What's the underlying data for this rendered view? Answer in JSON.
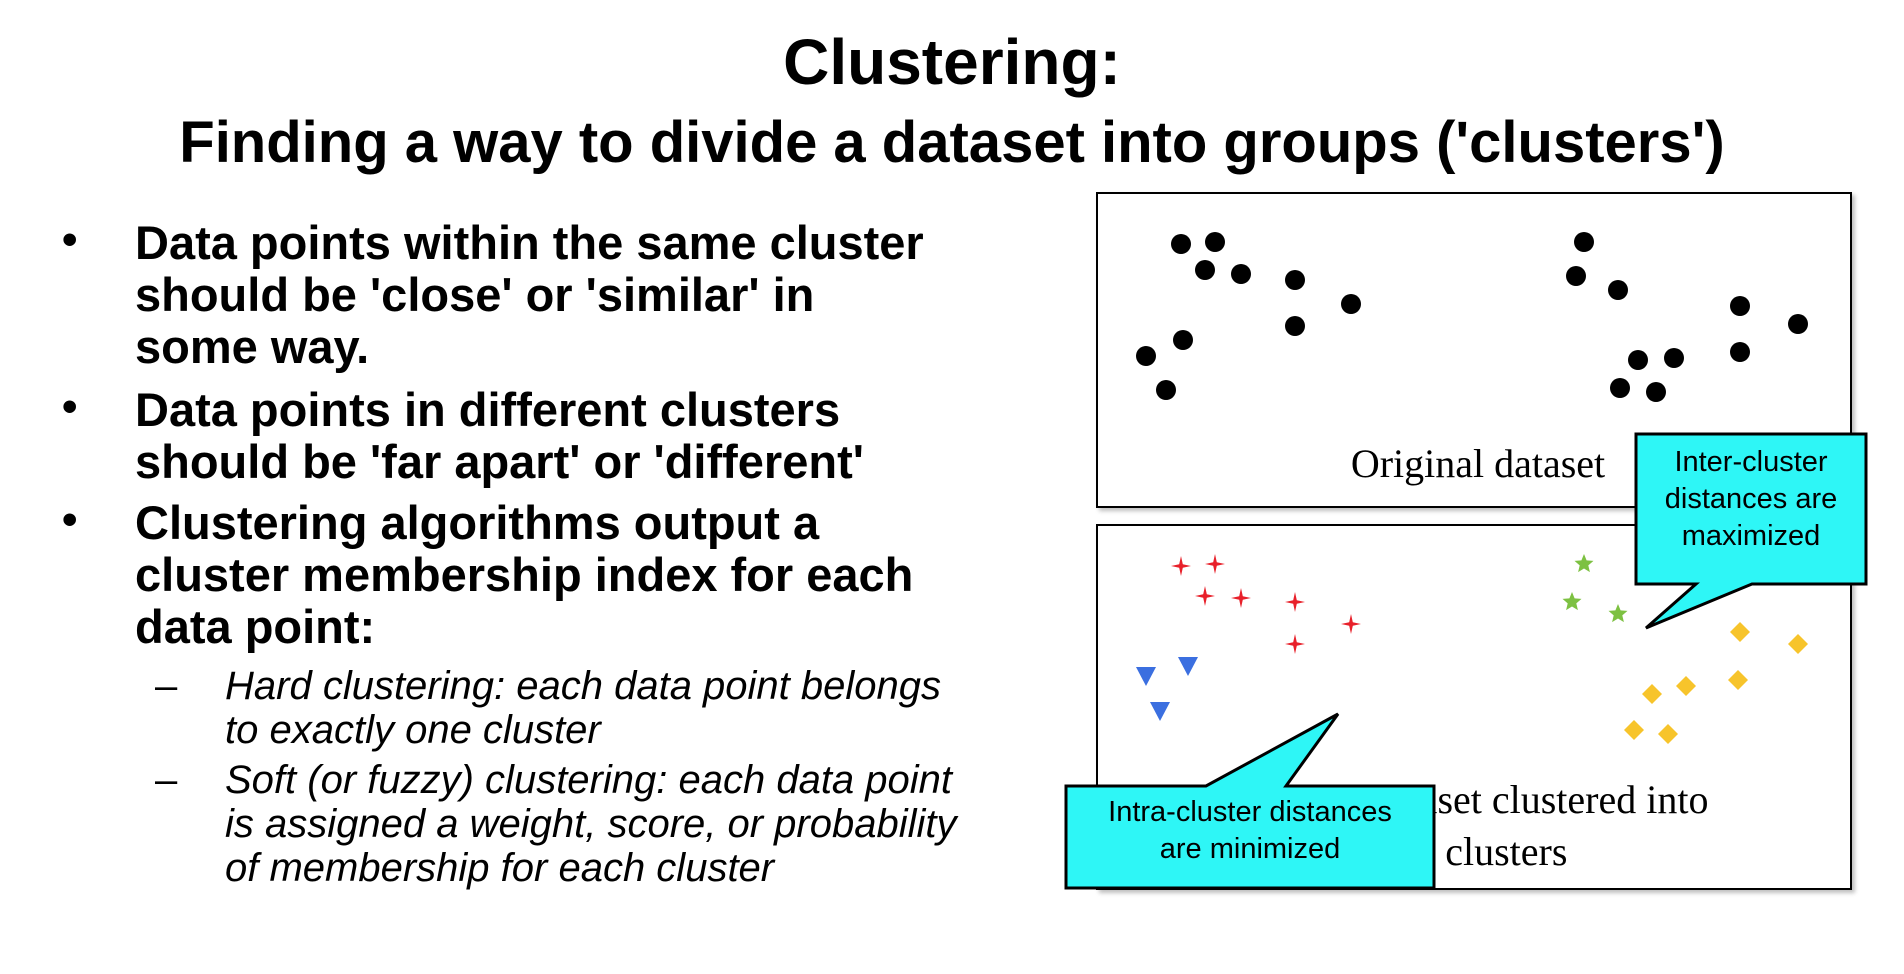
{
  "title": {
    "line1": "Clustering:",
    "line2": "Finding a way to divide a dataset into groups ('clusters')"
  },
  "bullets": [
    {
      "marker": "•",
      "text": "Data points within the same cluster\nshould be 'close' or 'similar' in\nsome way."
    },
    {
      "marker": "•",
      "text": "Data points in different clusters\nshould be 'far apart' or 'different'"
    },
    {
      "marker": "•",
      "text": "Clustering algorithms output a\ncluster membership index for each\ndata point:"
    }
  ],
  "subbullets": [
    {
      "marker": "–",
      "text": "Hard clustering: each data point belongs\nto exactly one cluster"
    },
    {
      "marker": "–",
      "text": "Soft (or fuzzy) clustering: each data point\nis assigned a weight, score, or probability\nof membership for each cluster"
    }
  ],
  "panels": {
    "original_caption": "Original dataset",
    "clustered_caption": "Original dataset clustered into\nfour clusters"
  },
  "callouts": {
    "inter": "Inter-cluster\ndistances are\nmaximized",
    "intra": "Intra-cluster distances\nare minimized"
  },
  "colors": {
    "cluster_red": "#e8202a",
    "cluster_green": "#7dc142",
    "cluster_blue": "#3b6fe0",
    "cluster_yellow": "#f7c42b",
    "callout_fill": "#2ef6f6"
  },
  "clusters": [
    {
      "marker": "star4",
      "color": "#e8202a",
      "points": [
        [
          83,
          40
        ],
        [
          117,
          38
        ],
        [
          107,
          70
        ],
        [
          143,
          72
        ],
        [
          197,
          76
        ],
        [
          197,
          118
        ],
        [
          253,
          98
        ]
      ]
    },
    {
      "marker": "triangle",
      "color": "#3b6fe0",
      "points": [
        [
          48,
          150
        ],
        [
          90,
          140
        ],
        [
          62,
          185
        ]
      ]
    },
    {
      "marker": "star5",
      "color": "#7dc142",
      "points": [
        [
          486,
          38
        ],
        [
          474,
          76
        ],
        [
          520,
          88
        ]
      ]
    },
    {
      "marker": "diamond",
      "color": "#f7c42b",
      "points": [
        [
          642,
          106
        ],
        [
          700,
          118
        ],
        [
          554,
          168
        ],
        [
          588,
          160
        ],
        [
          640,
          154
        ],
        [
          536,
          204
        ],
        [
          570,
          208
        ]
      ]
    }
  ]
}
